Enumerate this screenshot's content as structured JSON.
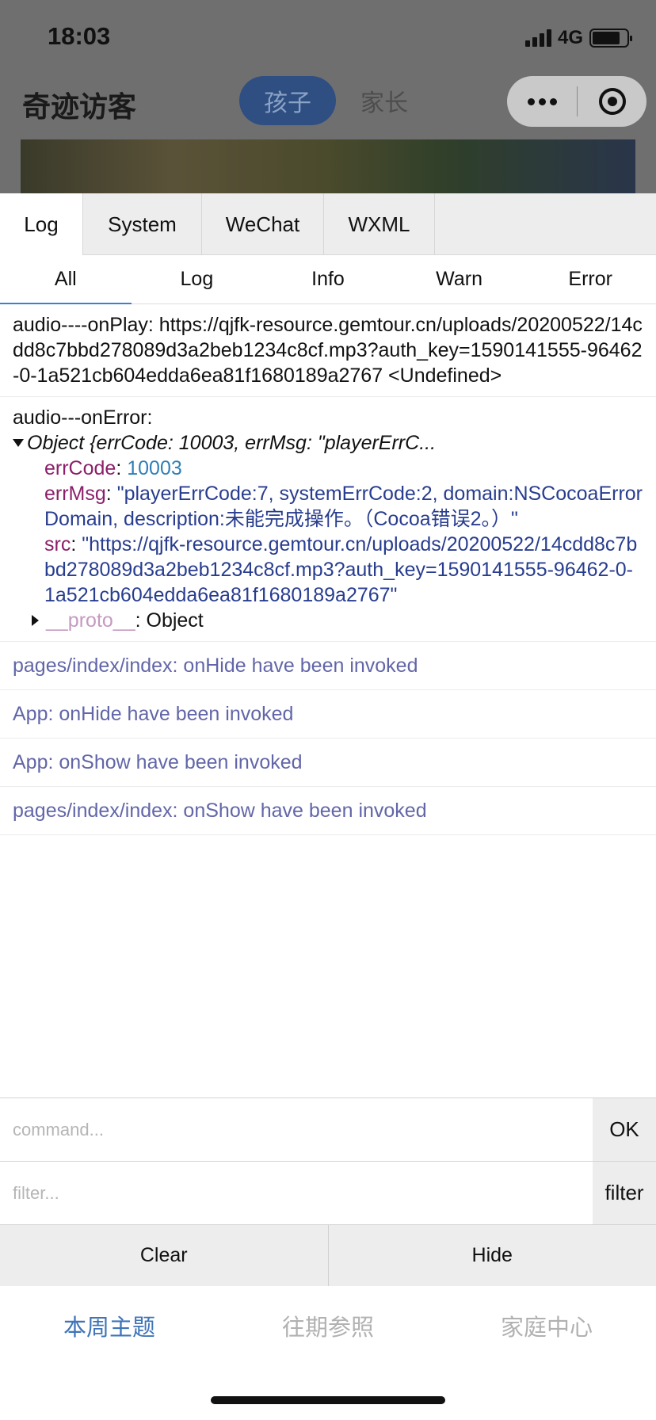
{
  "status": {
    "time": "18:03",
    "network": "4G"
  },
  "header": {
    "title": "奇迹访客",
    "segments": {
      "active": "孩子",
      "inactive": "家长"
    }
  },
  "console": {
    "tabs": [
      "Log",
      "System",
      "WeChat",
      "WXML"
    ],
    "filters": [
      "All",
      "Log",
      "Info",
      "Warn",
      "Error"
    ],
    "log_play": "audio----onPlay: https://qjfk-resource.gemtour.cn/uploads/20200522/14cdd8c7bbd278089d3a2beb1234c8cf.mp3?auth_key=1590141555-96462-0-1a521cb604edda6ea81f1680189a2767 <Undefined>",
    "log_error_label": "audio---onError:",
    "object_summary": "Object {errCode: 10003, errMsg: \"playerErrC...",
    "err_code_key": "errCode",
    "err_code_value": "10003",
    "err_msg_key": "errMsg",
    "err_msg_value": "\"playerErrCode:7, systemErrCode:2, domain:NSCocoaErrorDomain, description:未能完成操作。（Cocoa错误2。）\"",
    "src_key": "src",
    "src_value": "\"https://qjfk-resource.gemtour.cn/uploads/20200522/14cdd8c7bbd278089d3a2beb1234c8cf.mp3?auth_key=1590141555-96462-0-1a521cb604edda6ea81f1680189a2767\"",
    "proto_key": "__proto__",
    "proto_value": ": Object",
    "info_lines": [
      "pages/index/index: onHide have been invoked",
      "App: onHide have been invoked",
      "App: onShow have been invoked",
      "pages/index/index: onShow have been invoked"
    ],
    "command_placeholder": "command...",
    "command_button": "OK",
    "filter_placeholder": "filter...",
    "filter_button": "filter",
    "clear_button": "Clear",
    "hide_button": "Hide"
  },
  "tabbar": [
    "本周主题",
    "往期参照",
    "家庭中心"
  ],
  "icons": [
    "signal-icon",
    "battery-icon",
    "more-icon",
    "close-target-icon",
    "expand-triangle-icon",
    "collapsed-triangle-icon"
  ]
}
